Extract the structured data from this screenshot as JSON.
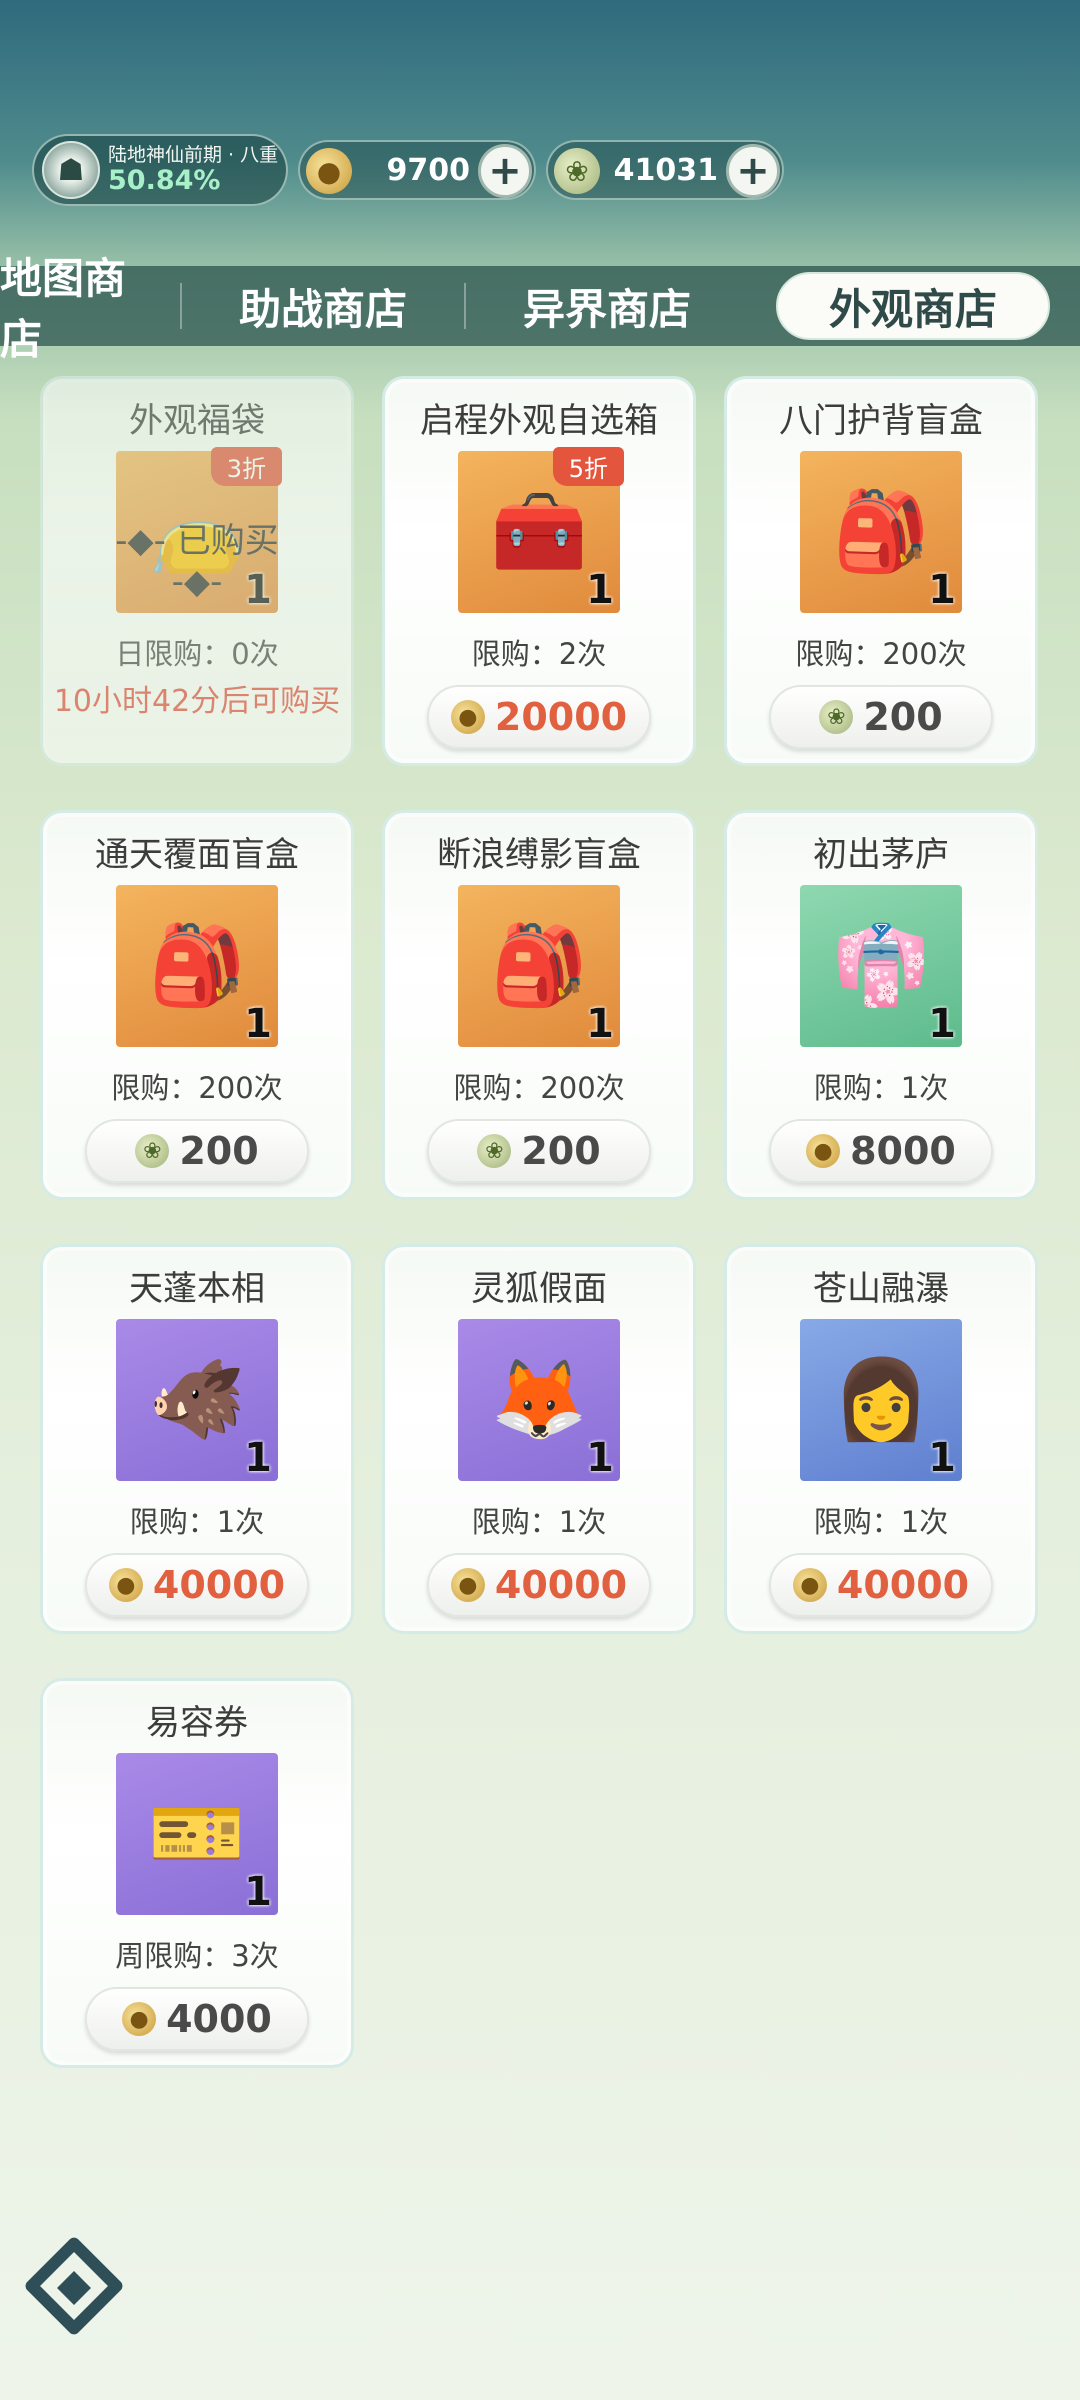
{
  "status": {
    "realm_name": "陆地神仙前期 · 八重",
    "realm_progress": "50.84%",
    "currency_gold": "9700",
    "currency_jade": "41031"
  },
  "tabs": [
    "地图商店",
    "助战商店",
    "异界商店",
    "外观商店"
  ],
  "items": [
    {
      "name": "外观福袋",
      "discount": "3折",
      "qty": "1",
      "bought": "已购买",
      "limit": "日限购：0次",
      "countdown": "10小时42分后可购买",
      "bg": "orange",
      "icon": "lucky-bag-icon"
    },
    {
      "name": "启程外观自选箱",
      "discount": "5折",
      "qty": "1",
      "limit": "限购：2次",
      "price": "20000",
      "currency": "gold",
      "bg": "orange",
      "icon": "treasure-chest-icon"
    },
    {
      "name": "八门护背盲盒",
      "qty": "1",
      "limit": "限购：200次",
      "price": "200",
      "currency": "jade",
      "bg": "orange",
      "icon": "blind-box-bag-icon"
    },
    {
      "name": "通天覆面盲盒",
      "qty": "1",
      "limit": "限购：200次",
      "price": "200",
      "currency": "jade",
      "bg": "orange",
      "icon": "blind-box-bag-icon"
    },
    {
      "name": "断浪缚影盲盒",
      "qty": "1",
      "limit": "限购：200次",
      "price": "200",
      "currency": "jade",
      "bg": "orange",
      "icon": "blind-box-bag-icon"
    },
    {
      "name": "初出茅庐",
      "qty": "1",
      "limit": "限购：1次",
      "price": "8000",
      "currency": "gold",
      "bg": "green",
      "icon": "outfit-icon"
    },
    {
      "name": "天蓬本相",
      "qty": "1",
      "limit": "限购：1次",
      "price": "40000",
      "currency": "gold",
      "bg": "purple",
      "icon": "boar-mask-icon"
    },
    {
      "name": "灵狐假面",
      "qty": "1",
      "limit": "限购：1次",
      "price": "40000",
      "currency": "gold",
      "bg": "purple",
      "icon": "fox-mask-icon"
    },
    {
      "name": "苍山融瀑",
      "qty": "1",
      "limit": "限购：1次",
      "price": "40000",
      "currency": "gold",
      "bg": "blue",
      "icon": "hairstyle-icon"
    },
    {
      "name": "易容券",
      "qty": "1",
      "limit": "周限购：3次",
      "price": "4000",
      "currency": "gold",
      "bg": "purple",
      "icon": "ticket-icon"
    }
  ]
}
